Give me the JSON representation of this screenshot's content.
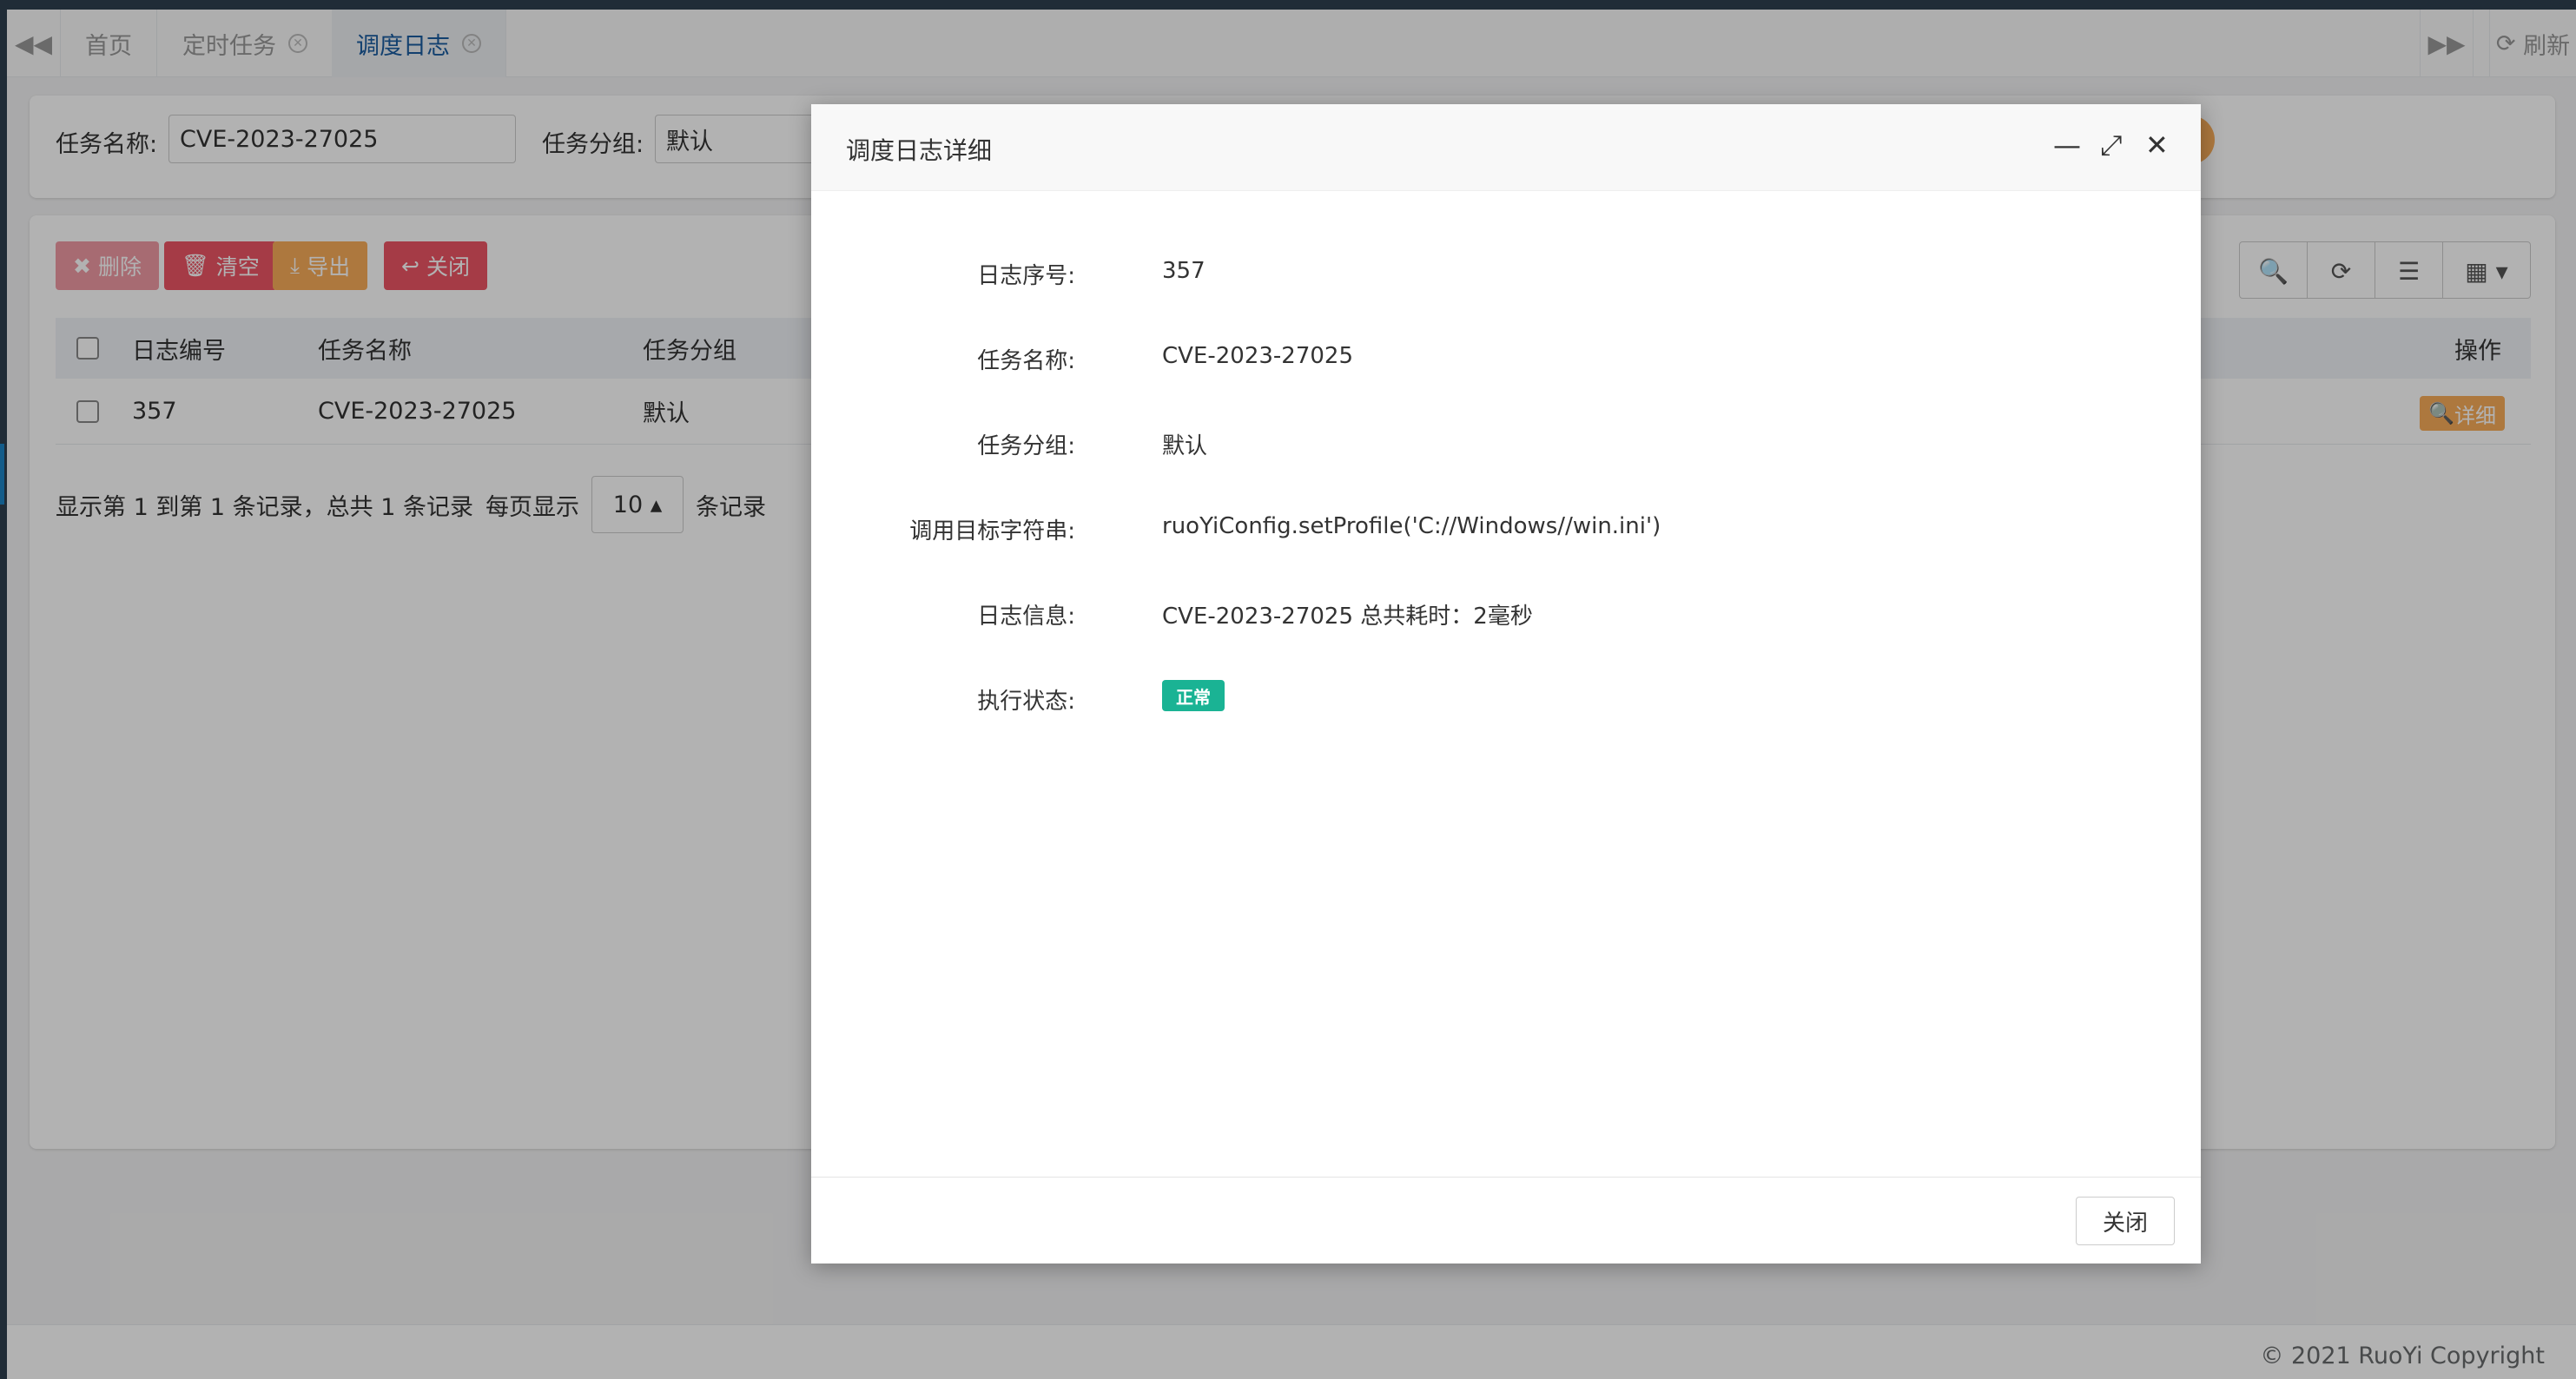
{
  "tabs": {
    "items": [
      {
        "label": "首页"
      },
      {
        "label": "定时任务"
      },
      {
        "label": "调度日志"
      }
    ],
    "refresh_label": "刷新"
  },
  "search": {
    "task_name_label": "任务名称:",
    "task_name_value": "CVE-2023-27025",
    "task_group_label": "任务分组:",
    "task_group_value": "默认"
  },
  "toolbar": {
    "delete_label": "删除",
    "clear_label": "清空",
    "export_label": "导出",
    "close_label": "关闭"
  },
  "table": {
    "headers": [
      "日志编号",
      "任务名称",
      "任务分组",
      "操作"
    ],
    "rows": [
      {
        "id": "357",
        "name": "CVE-2023-27025",
        "group": "默认",
        "action": "详细"
      }
    ]
  },
  "pager": {
    "summary": "显示第 1 到第 1 条记录，总共 1 条记录",
    "per_page_label": "每页显示",
    "per_page_value": "10",
    "suffix": "条记录"
  },
  "footer": {
    "copyright": "© 2021 RuoYi Copyright"
  },
  "modal": {
    "title": "调度日志详细",
    "fields": [
      {
        "label": "日志序号:",
        "value": "357"
      },
      {
        "label": "任务名称:",
        "value": "CVE-2023-27025"
      },
      {
        "label": "任务分组:",
        "value": "默认"
      },
      {
        "label": "调用目标字符串:",
        "value": "ruoYiConfig.setProfile('C://Windows//win.ini')"
      },
      {
        "label": "日志信息:",
        "value": "CVE-2023-27025 总共耗时：2毫秒"
      },
      {
        "label": "执行状态:",
        "value": "正常"
      }
    ],
    "close_label": "关闭"
  },
  "colors": {
    "accent": "#1a5c9f",
    "danger": "#ed5565",
    "warning": "#f8ac59",
    "success": "#1ab394"
  }
}
